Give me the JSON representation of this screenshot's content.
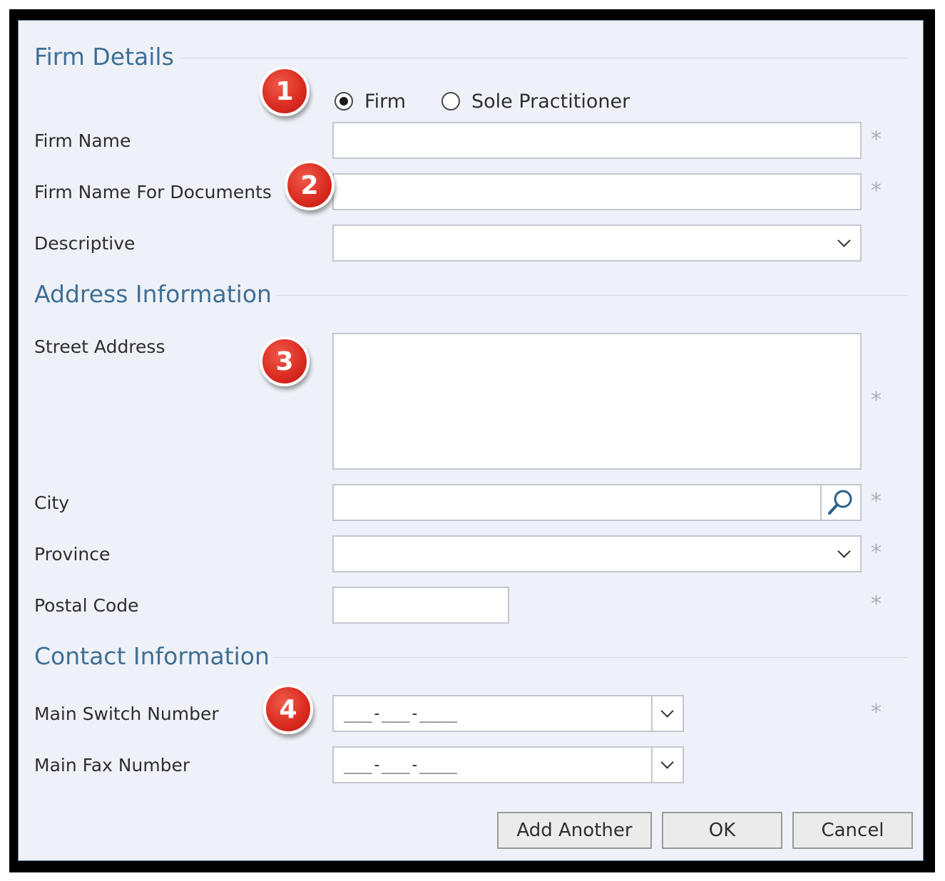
{
  "sections": {
    "firm_details": "Firm Details",
    "address_information": "Address Information",
    "contact_information": "Contact Information"
  },
  "firm_type": {
    "options": [
      "Firm",
      "Sole Practitioner"
    ],
    "selected": "Firm"
  },
  "labels": {
    "firm_name": "Firm Name",
    "firm_name_for_documents": "Firm Name For Documents",
    "descriptive": "Descriptive",
    "street_address": "Street Address",
    "city": "City",
    "province": "Province",
    "postal_code": "Postal Code",
    "main_switch_number": "Main Switch Number",
    "main_fax_number": "Main Fax Number"
  },
  "values": {
    "firm_name": "",
    "firm_name_for_documents": "",
    "descriptive": "",
    "street_address": "",
    "city": "",
    "province": "",
    "postal_code": "",
    "main_switch_number": "___-___-____",
    "main_fax_number": "___-___-____"
  },
  "required_marker": "*",
  "badges": [
    "1",
    "2",
    "3",
    "4"
  ],
  "buttons": {
    "add_another": "Add Another",
    "ok": "OK",
    "cancel": "Cancel"
  },
  "colors": {
    "section_title": "#3f6f95",
    "badge": "#d92a1f",
    "dialog_bg": "#eff1f8"
  }
}
